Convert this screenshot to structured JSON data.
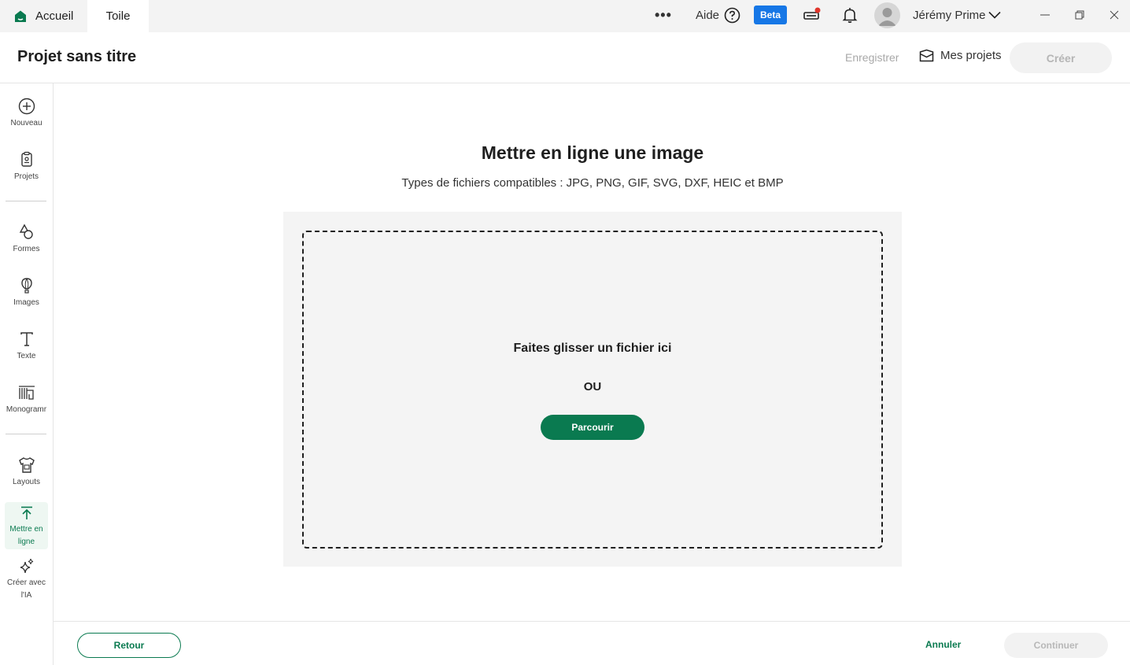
{
  "titlebar": {
    "home_tab": "Accueil",
    "canvas_tab": "Toile",
    "more": "•••",
    "help": "Aide",
    "beta": "Beta",
    "user_name": "Jérémy Prime"
  },
  "header": {
    "project_title": "Projet sans titre",
    "save": "Enregistrer",
    "my_projects": "Mes projets",
    "create": "Créer"
  },
  "sidebar": {
    "items": [
      {
        "label": "Nouveau"
      },
      {
        "label": "Projets"
      },
      {
        "label": "Formes"
      },
      {
        "label": "Images"
      },
      {
        "label": "Texte"
      },
      {
        "label": "Monogramr"
      },
      {
        "label": "Layouts"
      },
      {
        "label_line1": "Mettre en",
        "label_line2": "ligne"
      },
      {
        "label_line1": "Créer avec",
        "label_line2": "l'IA"
      }
    ]
  },
  "main": {
    "title": "Mettre en ligne une image",
    "subtitle": "Types de fichiers compatibles :  JPG, PNG, GIF, SVG, DXF, HEIC et BMP",
    "drop_text": "Faites glisser un fichier ici",
    "or": "OU",
    "browse": "Parcourir"
  },
  "footer": {
    "back": "Retour",
    "cancel": "Annuler",
    "continue": "Continuer"
  },
  "colors": {
    "brand_green": "#0a7a50",
    "beta_blue": "#1677e6",
    "notification_red": "#e0352b"
  }
}
